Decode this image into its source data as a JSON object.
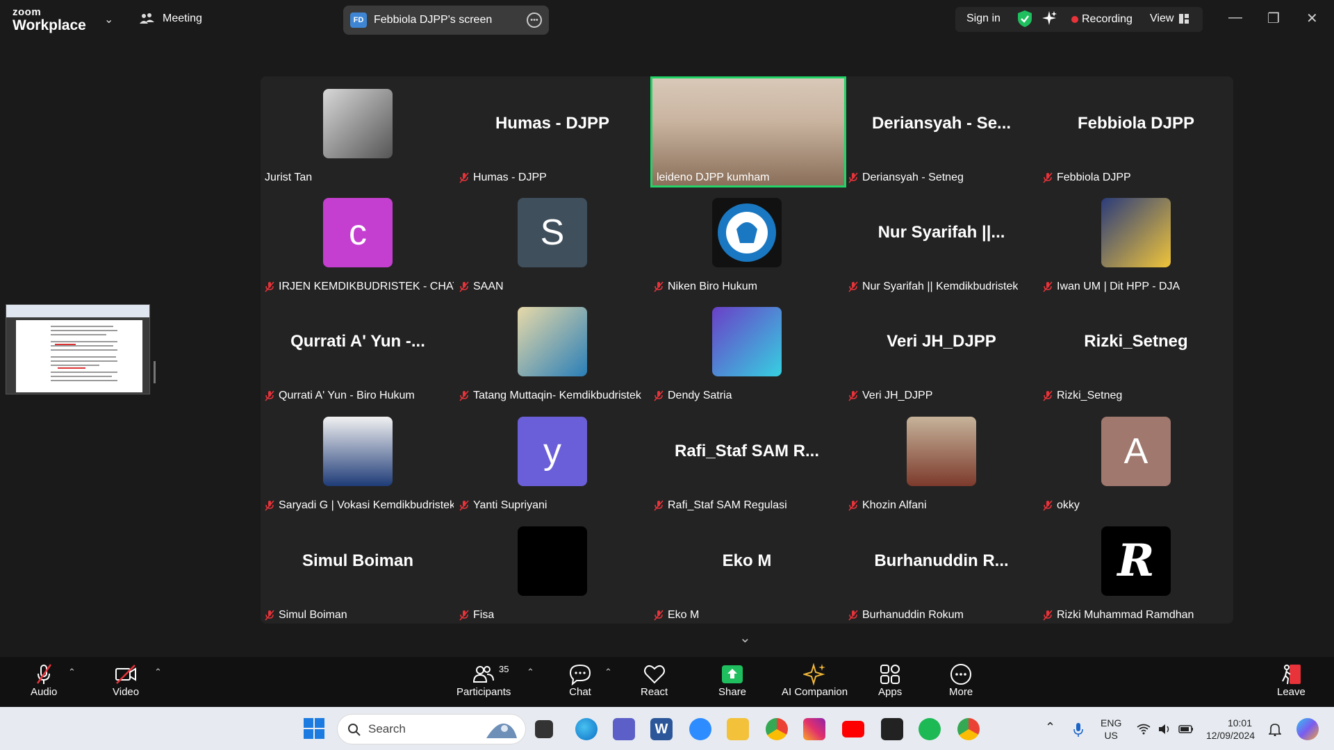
{
  "app": {
    "brand_small": "zoom",
    "brand_large": "Workplace",
    "meeting_label": "Meeting",
    "screen_share_initials": "FD",
    "screen_share_label": "Febbiola DJPP's screen",
    "signin_label": "Sign in",
    "recording_label": "Recording",
    "view_label": "View"
  },
  "participants": [
    {
      "label": "Jurist Tan",
      "display": "photo",
      "muted": false
    },
    {
      "label": "Humas - DJPP",
      "display": "name",
      "big": "Humas - DJPP",
      "muted": true
    },
    {
      "label": "leideno DJPP kumham",
      "display": "video",
      "muted": false,
      "active": true
    },
    {
      "label": "Deriansyah - Setneg",
      "display": "name",
      "big": "Deriansyah - Se...",
      "muted": true
    },
    {
      "label": "Febbiola DJPP",
      "display": "name",
      "big": "Febbiola DJPP",
      "muted": true
    },
    {
      "label": "IRJEN KEMDIKBUDRISTEK - CHATA...",
      "display": "letter",
      "letter": "c",
      "muted": true
    },
    {
      "label": "SAAN",
      "display": "letter",
      "letter": "S",
      "muted": true
    },
    {
      "label": "Niken Biro Hukum",
      "display": "logo",
      "muted": true
    },
    {
      "label": "Nur Syarifah || Kemdikbudristek",
      "display": "name",
      "big": "Nur Syarifah ||...",
      "muted": true
    },
    {
      "label": "Iwan UM | Dit HPP - DJA",
      "display": "photo",
      "muted": true
    },
    {
      "label": "Qurrati A' Yun - Biro Hukum",
      "display": "name",
      "big": "Qurrati A' Yun -...",
      "muted": true
    },
    {
      "label": "Tatang Muttaqin- Kemdikbudristek",
      "display": "photo",
      "muted": true
    },
    {
      "label": "Dendy Satria",
      "display": "photo",
      "muted": true
    },
    {
      "label": "Veri JH_DJPP",
      "display": "name",
      "big": "Veri JH_DJPP",
      "muted": true
    },
    {
      "label": "Rizki_Setneg",
      "display": "name",
      "big": "Rizki_Setneg",
      "muted": true
    },
    {
      "label": "Saryadi G | Vokasi Kemdikbudristek",
      "display": "photo",
      "muted": true
    },
    {
      "label": "Yanti Supriyani",
      "display": "letter",
      "letter": "y",
      "muted": true
    },
    {
      "label": "Rafi_Staf SAM Regulasi",
      "display": "name",
      "big": "Rafi_Staf SAM R...",
      "muted": true
    },
    {
      "label": "Khozin Alfani",
      "display": "photo",
      "muted": true
    },
    {
      "label": "okky",
      "display": "letter",
      "letter": "A",
      "muted": true
    },
    {
      "label": "Simul Boiman",
      "display": "name",
      "big": "Simul Boiman",
      "muted": true
    },
    {
      "label": "Fisa",
      "display": "black",
      "muted": true
    },
    {
      "label": "Eko M",
      "display": "name",
      "big": "Eko M",
      "muted": true
    },
    {
      "label": "Burhanuddin Rokum",
      "display": "name",
      "big": "Burhanuddin R...",
      "muted": true
    },
    {
      "label": "Rizki Muhammad Ramdhan",
      "display": "logo-r",
      "muted": true
    }
  ],
  "toolbar": {
    "audio": "Audio",
    "video": "Video",
    "participants": "Participants",
    "participants_count": "35",
    "chat": "Chat",
    "react": "React",
    "share": "Share",
    "ai_companion": "AI Companion",
    "apps": "Apps",
    "more": "More",
    "leave": "Leave"
  },
  "taskbar": {
    "search_placeholder": "Search",
    "lang_top": "ENG",
    "lang_bottom": "US",
    "time": "10:01",
    "date": "12/09/2024"
  },
  "colors": {
    "active_border": "#22d468",
    "mute_red": "#e8333a",
    "avatar_c": "#c43fd0",
    "avatar_s": "#3f4f5c",
    "avatar_y": "#6a5fd8",
    "avatar_a": "#a0786e",
    "share_green": "#1fbf5f"
  }
}
